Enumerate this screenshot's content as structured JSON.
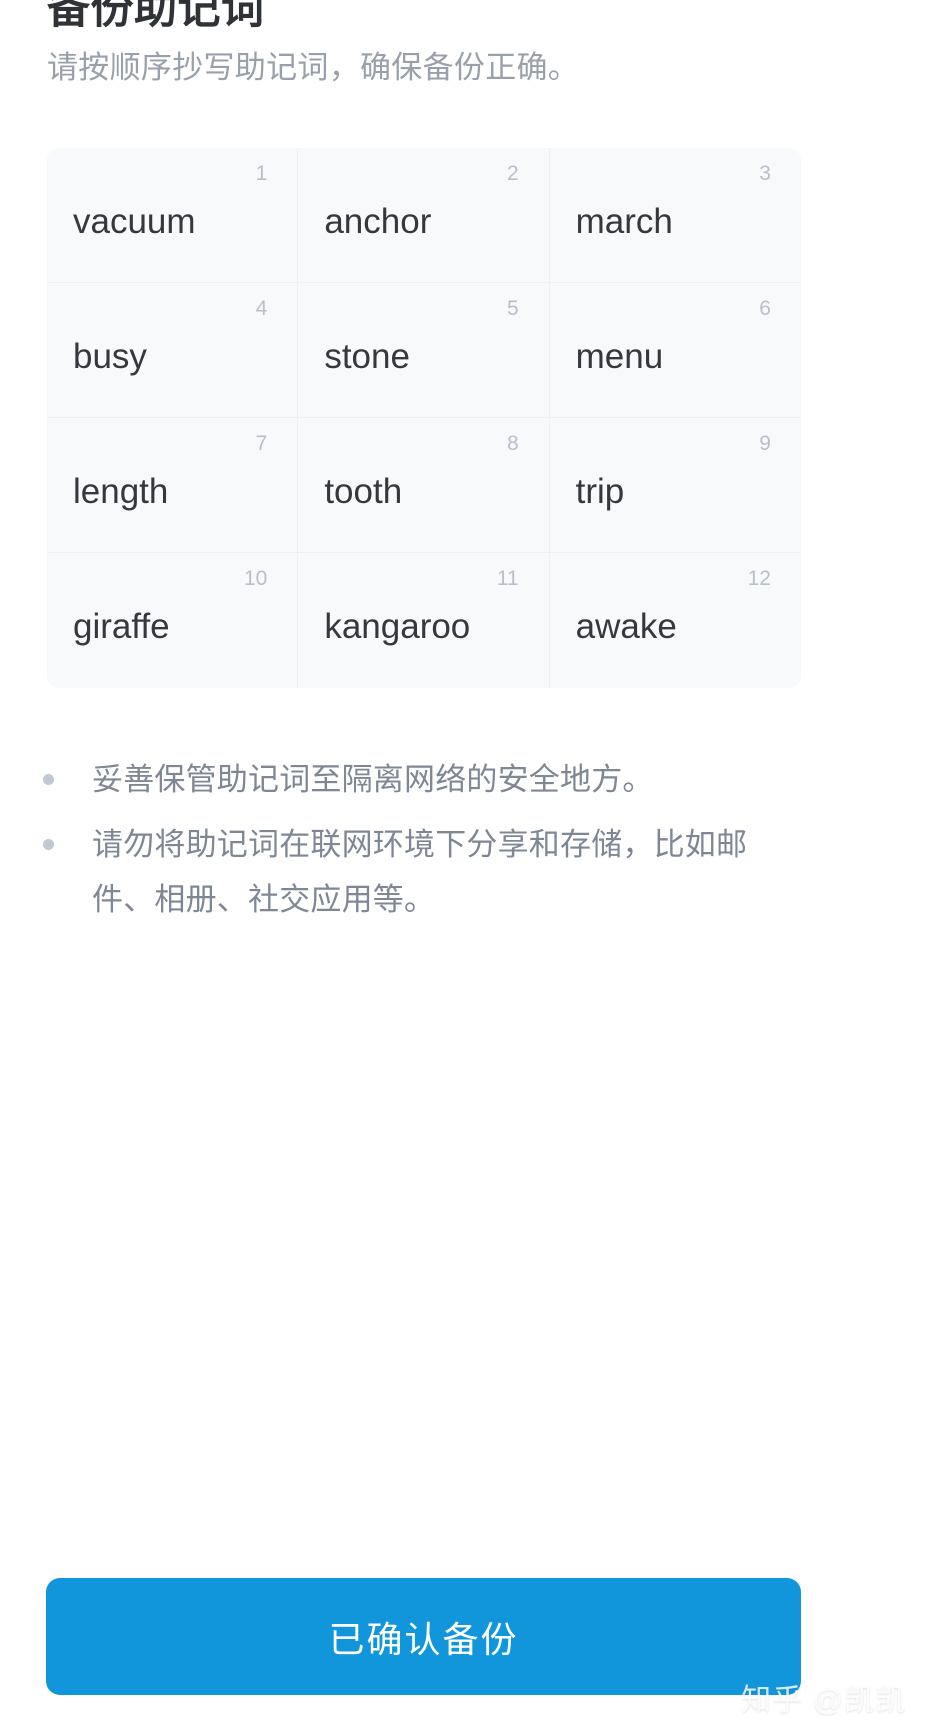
{
  "header": {
    "title": "备份助记词",
    "subtitle": "请按顺序抄写助记词，确保备份正确。"
  },
  "mnemonic": {
    "words": [
      {
        "index": "1",
        "word": "vacuum"
      },
      {
        "index": "2",
        "word": "anchor"
      },
      {
        "index": "3",
        "word": "march"
      },
      {
        "index": "4",
        "word": "busy"
      },
      {
        "index": "5",
        "word": "stone"
      },
      {
        "index": "6",
        "word": "menu"
      },
      {
        "index": "7",
        "word": "length"
      },
      {
        "index": "8",
        "word": "tooth"
      },
      {
        "index": "9",
        "word": "trip"
      },
      {
        "index": "10",
        "word": "giraffe"
      },
      {
        "index": "11",
        "word": "kangaroo"
      },
      {
        "index": "12",
        "word": "awake"
      }
    ]
  },
  "notices": [
    {
      "text": "妥善保管助记词至隔离网络的安全地方。"
    },
    {
      "text": "请勿将助记词在联网环境下分享和存储，比如邮件、相册、社交应用等。"
    }
  ],
  "actions": {
    "confirm_label": "已确认备份"
  },
  "watermark": {
    "text": "知乎 @凯凯"
  },
  "colors": {
    "accent": "#1296db",
    "title_text": "#2f3237",
    "subtitle_text": "#9aa0ab",
    "word_text": "#35383d",
    "word_index": "#b9bfc9",
    "notice_text": "#7f8795",
    "card_bg": "#f8f9fb",
    "cell_divider": "#eef0f3"
  }
}
